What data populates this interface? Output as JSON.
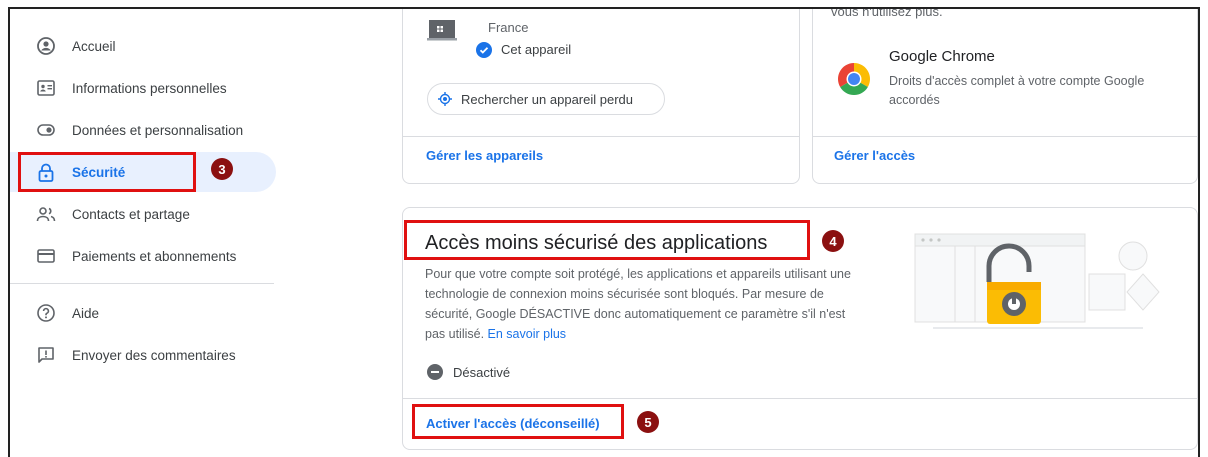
{
  "sidebar": {
    "items": [
      {
        "label": "Accueil",
        "icon": "account-circle-icon"
      },
      {
        "label": "Informations personnelles",
        "icon": "id-card-icon"
      },
      {
        "label": "Données et personnalisation",
        "icon": "toggle-icon"
      },
      {
        "label": "Sécurité",
        "icon": "lock-icon"
      },
      {
        "label": "Contacts et partage",
        "icon": "people-icon"
      },
      {
        "label": "Paiements et abonnements",
        "icon": "credit-card-icon"
      }
    ],
    "secondary": [
      {
        "label": "Aide",
        "icon": "help-icon"
      },
      {
        "label": "Envoyer des commentaires",
        "icon": "feedback-icon"
      }
    ]
  },
  "devices_card": {
    "location": "France",
    "this_device": "Cet appareil",
    "find_device_button": "Rechercher un appareil perdu",
    "manage_link": "Gérer les appareils"
  },
  "apps_card": {
    "top_text": "vous n'utilisez plus.",
    "app_name": "Google Chrome",
    "app_desc": "Droits d'accès complet à votre compte Google accordés",
    "manage_link": "Gérer l'accès"
  },
  "less_secure_card": {
    "title": "Accès moins sécurisé des applications",
    "description": "Pour que votre compte soit protégé, les applications et appareils utilisant une technologie de connexion moins sécurisée sont bloqués. Par mesure de sécurité, Google DÉSACTIVE donc automatiquement ce paramètre s'il n'est pas utilisé.",
    "learn_more": "En savoir plus",
    "status": "Désactivé",
    "enable_link": "Activer l'accès (déconseillé)"
  },
  "annotations": [
    "3",
    "4",
    "5"
  ],
  "colors": {
    "accent": "#1a73e8",
    "highlight": "#e01010",
    "badge": "#8b1010",
    "lock": "#f9ab00"
  }
}
